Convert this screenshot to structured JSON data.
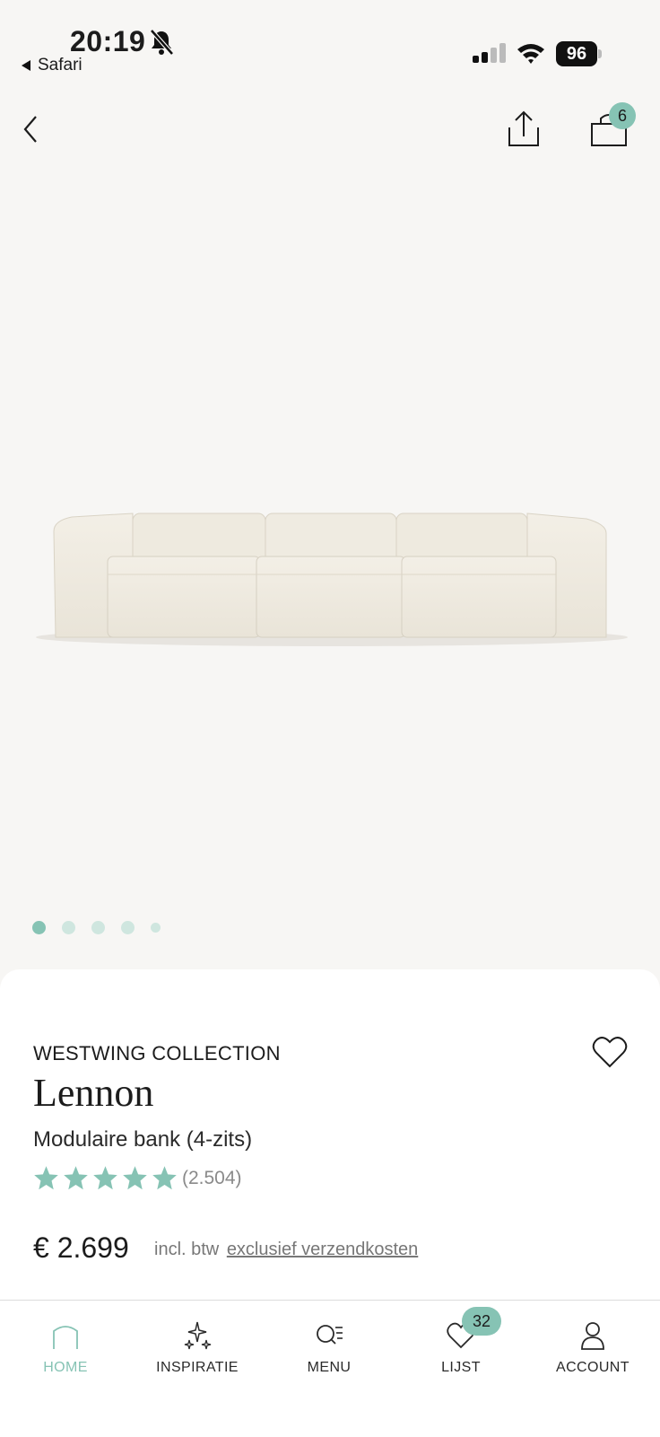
{
  "status_bar": {
    "time": "20:19",
    "back_app": "Safari",
    "battery": "96"
  },
  "header": {
    "cart_count": "6"
  },
  "gallery": {
    "image_count": 5,
    "active_index": 0
  },
  "product": {
    "brand": "WESTWING COLLECTION",
    "name": "Lennon",
    "subtitle": "Modulaire bank (4-zits)",
    "rating": 5,
    "review_count": "(2.504)",
    "price": "€ 2.699",
    "vat_note": "incl. btw",
    "shipping_link": "exclusief verzendkosten"
  },
  "tab_bar": {
    "home": "HOME",
    "inspiratie": "INSPIRATIE",
    "menu": "MENU",
    "lijst": "LIJST",
    "account": "ACCOUNT",
    "lijst_count": "32"
  },
  "colors": {
    "accent": "#86c3b4",
    "accent_light": "#cfe6df",
    "background": "#f7f6f4"
  }
}
